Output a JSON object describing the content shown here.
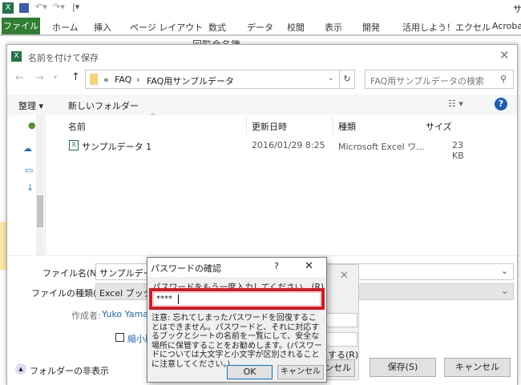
{
  "excel": {
    "quick_access": [
      "excel-logo",
      "save-icon",
      "undo-icon",
      "redo-icon",
      "customize-icon"
    ],
    "title_fragment": "サ",
    "tabs": [
      "ファイル",
      "ホーム",
      "挿入",
      "ページ レイアウト",
      "数式",
      "データ",
      "校閲",
      "表示",
      "開発",
      "活用しよう！エクセル",
      "Acroba"
    ],
    "formula_fragment": "回覧会名簿"
  },
  "save_dialog": {
    "title": "名前を付けて保存",
    "breadcrumb": [
      "«",
      "FAQ",
      "›",
      "FAQ用サンプルデータ"
    ],
    "search_placeholder": "FAQ用サンプルデータの検索",
    "organize": "整理 ▾",
    "new_folder": "新しいフォルダー",
    "columns": [
      "名前",
      "更新日時",
      "種類",
      "サイズ"
    ],
    "files": [
      {
        "name": "サンプルデータ 1",
        "modified": "2016/01/29 8:25",
        "type": "Microsoft Excel ワ...",
        "size": "23 KB"
      }
    ],
    "filename_label": "ファイル名(N):",
    "filename_value": "サンプルデータ 1",
    "filetype_label": "ファイルの種類(T):",
    "filetype_value": "Excel ブック",
    "author_label": "作成者:",
    "author_value": "Yuko  Yamada",
    "thumbnail_label": "縮小版を保存する",
    "hide_folders": "フォルダーの非表示",
    "save": "保存(S)",
    "cancel": "キャンセル"
  },
  "options_dialog": {
    "fragment_label": "する(R)",
    "fragment_button": "ンセル"
  },
  "password_dialog": {
    "title": "パスワードの確認",
    "help": "?",
    "close": "✕",
    "prompt": "パスワードをもう一度入力してください。(R)",
    "value": "****",
    "highlight_color": "#e0141e",
    "note": "注意: 忘れてしまったパスワードを回復することはできません。パスワードと、それに対応するブックとシートの名前を一覧にして、安全な場所に保管することをお勧めします。(パスワードについては大文字と小文字が区別されることに注意してください。)",
    "ok": "OK",
    "cancel": "キャンセル"
  }
}
